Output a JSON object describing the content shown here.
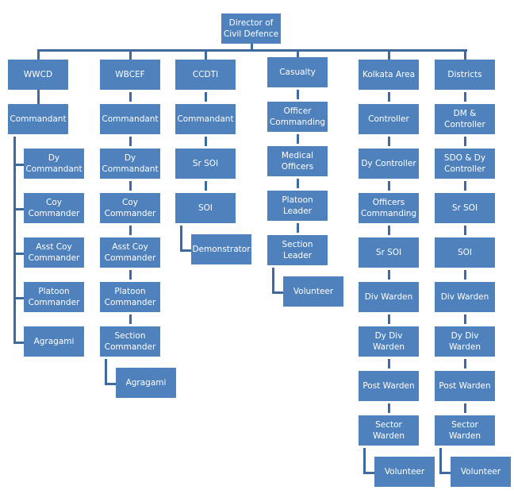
{
  "title": "Director of\nCivil Defence",
  "colors": {
    "box": "#4f81bd",
    "connector": "#3c6a9e",
    "text": "#ffffff"
  },
  "branches": [
    {
      "name": "WWCD",
      "layout": "side",
      "head": "Commandant",
      "items": [
        "Dy\nCommandant",
        "Coy\nCommander",
        "Asst Coy\nCommander",
        "Platoon\nCommander",
        "Agragami"
      ]
    },
    {
      "name": "WBCEF",
      "layout": "chain",
      "items": [
        "Commandant",
        "Dy\nCommandant",
        "Coy\nCommander",
        "Asst Coy\nCommander",
        "Platoon\nCommander",
        "Section\nCommander"
      ],
      "leaf": "Agragami"
    },
    {
      "name": "CCDTI",
      "layout": "chain",
      "items": [
        "Commandant",
        "Sr SOI",
        "SOI"
      ],
      "leaf": "Demonstrator"
    },
    {
      "name": "Casualty",
      "layout": "chain",
      "items": [
        "Officer\nCommanding",
        "Medical\nOfficers",
        "Platoon\nLeader",
        "Section\nLeader"
      ],
      "leaf": "Volunteer"
    },
    {
      "name": "Kolkata Area",
      "layout": "chain",
      "items": [
        "Controller",
        "Dy Controller",
        "Officers\nCommanding",
        "Sr SOI",
        "Div Warden",
        "Dy Div\nWarden",
        "Post Warden",
        "Sector\nWarden"
      ],
      "leaf": "Volunteer"
    },
    {
      "name": "Districts",
      "layout": "chain",
      "items": [
        "DM &\nController",
        "SDO & Dy\nController",
        "Sr SOI",
        "SOI",
        "Div Warden",
        "Dy Div\nWarden",
        "Post Warden",
        "Sector\nWarden"
      ],
      "leaf": "Volunteer"
    }
  ]
}
